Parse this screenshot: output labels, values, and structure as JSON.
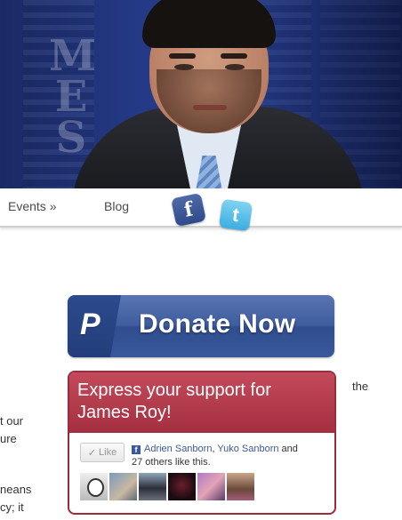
{
  "header": {
    "banner_letters": [
      "M",
      "E",
      "S"
    ]
  },
  "nav": {
    "items": [
      {
        "label": "Events »"
      },
      {
        "label": "Blog"
      }
    ],
    "social": {
      "facebook_glyph": "f",
      "twitter_glyph": "t"
    }
  },
  "left_column": {
    "snippets": [
      "the",
      "t our",
      "ure",
      "neans",
      "cy; it"
    ]
  },
  "donate": {
    "logo_text": "P",
    "label": "Donate Now"
  },
  "support": {
    "title": "Express your support for James Roy!",
    "like_button": "Like",
    "friend1": "Adrien Sanborn",
    "separator": ", ",
    "friend2": "Yuko Sanborn",
    "and": " and",
    "others": "27 others like this.",
    "colors": {
      "header": "#a42f40",
      "border": "#9c2c3c",
      "link": "#3b5998"
    }
  },
  "icons": {
    "facebook": "facebook-icon",
    "twitter": "twitter-icon",
    "paypal": "paypal-icon",
    "check": "check-icon"
  }
}
